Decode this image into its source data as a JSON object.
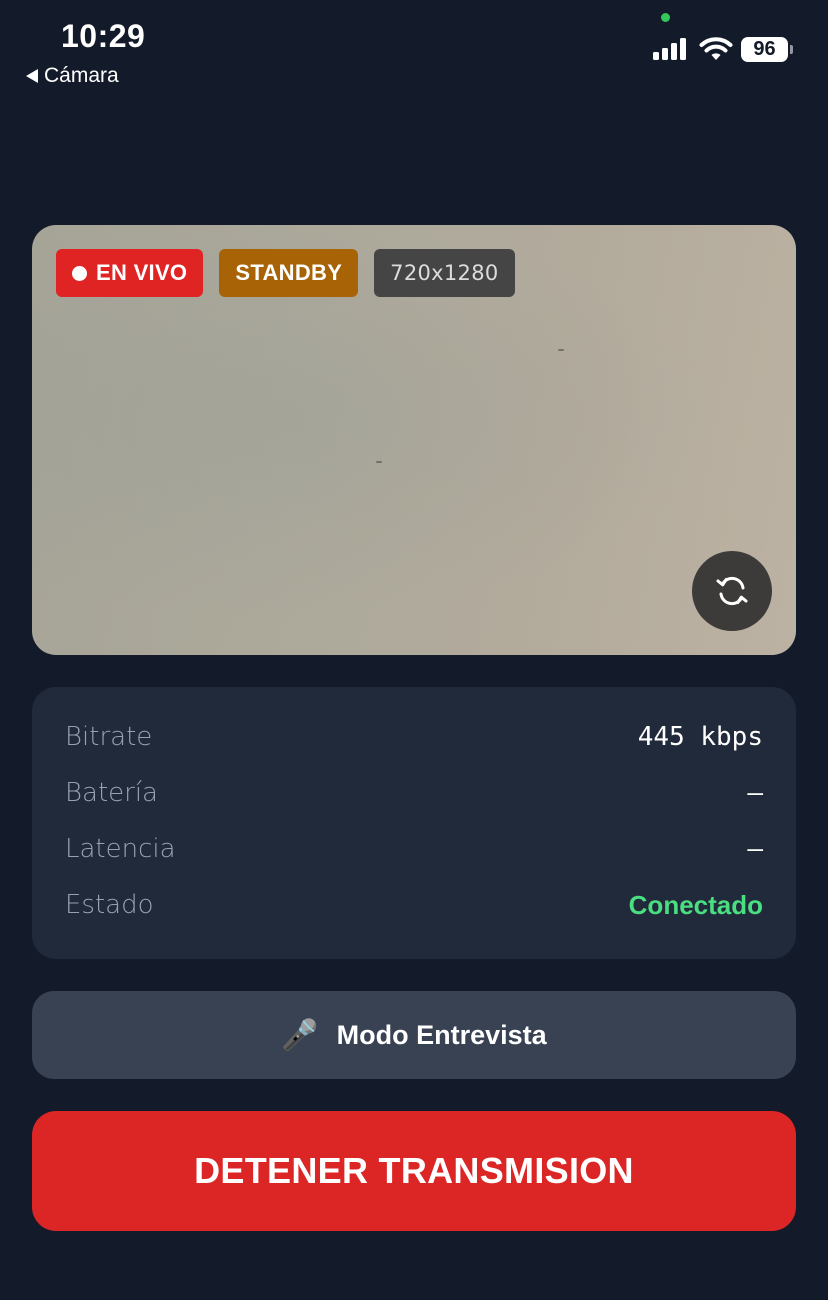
{
  "status_bar": {
    "time": "10:29",
    "back_label": "Cámara",
    "battery_level": "96",
    "signal_bars": 4,
    "privacy_indicator_color": "#34c759"
  },
  "preview": {
    "badges": {
      "live": "EN VIVO",
      "standby": "STANDBY",
      "resolution": "720x1280"
    },
    "flip_camera_icon": "camera-switch-icon"
  },
  "stats": [
    {
      "label": "Bitrate",
      "value": "445 kbps"
    },
    {
      "label": "Batería",
      "value": "–"
    },
    {
      "label": "Latencia",
      "value": "–"
    },
    {
      "label": "Estado",
      "value": "Conectado"
    }
  ],
  "actions": {
    "interview_icon": "🎤",
    "interview_label": "Modo Entrevista",
    "stop_label": "DETENER TRANSMISION"
  },
  "colors": {
    "background": "#131a29",
    "card": "#212a3b",
    "live_red": "#e02424",
    "standby_amber": "#a86306",
    "connected_green": "#4ade80",
    "stop_red": "#dc2626",
    "secondary_button": "#384253"
  }
}
